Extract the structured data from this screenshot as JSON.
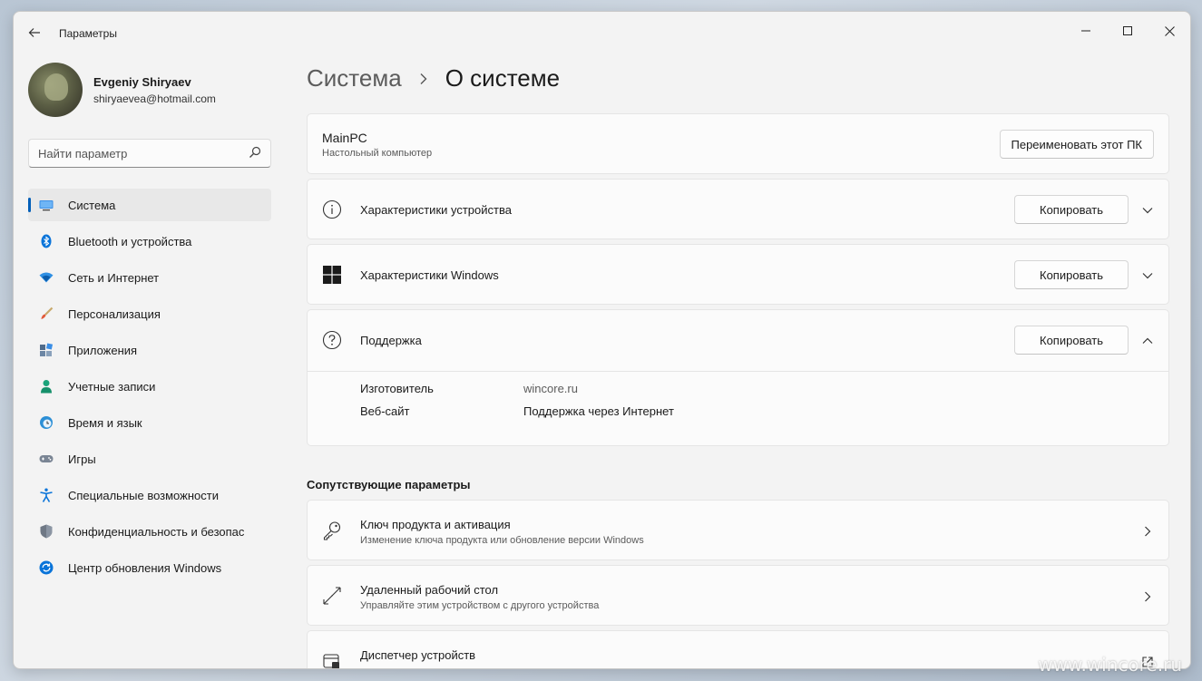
{
  "window": {
    "title": "Параметры"
  },
  "profile": {
    "name": "Evgeniy Shiryaev",
    "email": "shiryaevea@hotmail.com"
  },
  "search": {
    "placeholder": "Найти параметр"
  },
  "nav": {
    "items": [
      {
        "label": "Система",
        "icon": "monitor-icon",
        "active": true
      },
      {
        "label": "Bluetooth и устройства",
        "icon": "bluetooth-icon"
      },
      {
        "label": "Сеть и Интернет",
        "icon": "wifi-icon"
      },
      {
        "label": "Персонализация",
        "icon": "brush-icon"
      },
      {
        "label": "Приложения",
        "icon": "apps-icon"
      },
      {
        "label": "Учетные записи",
        "icon": "person-icon"
      },
      {
        "label": "Время и язык",
        "icon": "clock-globe-icon"
      },
      {
        "label": "Игры",
        "icon": "gamepad-icon"
      },
      {
        "label": "Специальные возможности",
        "icon": "accessibility-icon"
      },
      {
        "label": "Конфиденциальность и безопас",
        "icon": "shield-icon"
      },
      {
        "label": "Центр обновления Windows",
        "icon": "update-icon"
      }
    ]
  },
  "breadcrumb": {
    "parent": "Система",
    "current": "О системе"
  },
  "pc": {
    "name": "MainPC",
    "type": "Настольный компьютер",
    "rename_label": "Переименовать этот ПК"
  },
  "sections": {
    "device_specs": {
      "title": "Характеристики устройства",
      "copy_label": "Копировать"
    },
    "windows_specs": {
      "title": "Характеристики Windows",
      "copy_label": "Копировать"
    },
    "support": {
      "title": "Поддержка",
      "copy_label": "Копировать",
      "rows": [
        {
          "key": "Изготовитель",
          "value": "wincore.ru"
        },
        {
          "key": "Веб-сайт",
          "value": "Поддержка через Интернет"
        }
      ]
    }
  },
  "related": {
    "title": "Сопутствующие параметры",
    "items": [
      {
        "title": "Ключ продукта и активация",
        "subtitle": "Изменение ключа продукта или обновление версии Windows"
      },
      {
        "title": "Удаленный рабочий стол",
        "subtitle": "Управляйте этим устройством с другого устройства"
      },
      {
        "title": "Диспетчер устройств",
        "subtitle": ""
      }
    ]
  },
  "watermark": "www.wincore.ru",
  "colors": {
    "accent": "#005fb8",
    "background": "#f3f3f3",
    "card": "#fbfbfb"
  }
}
